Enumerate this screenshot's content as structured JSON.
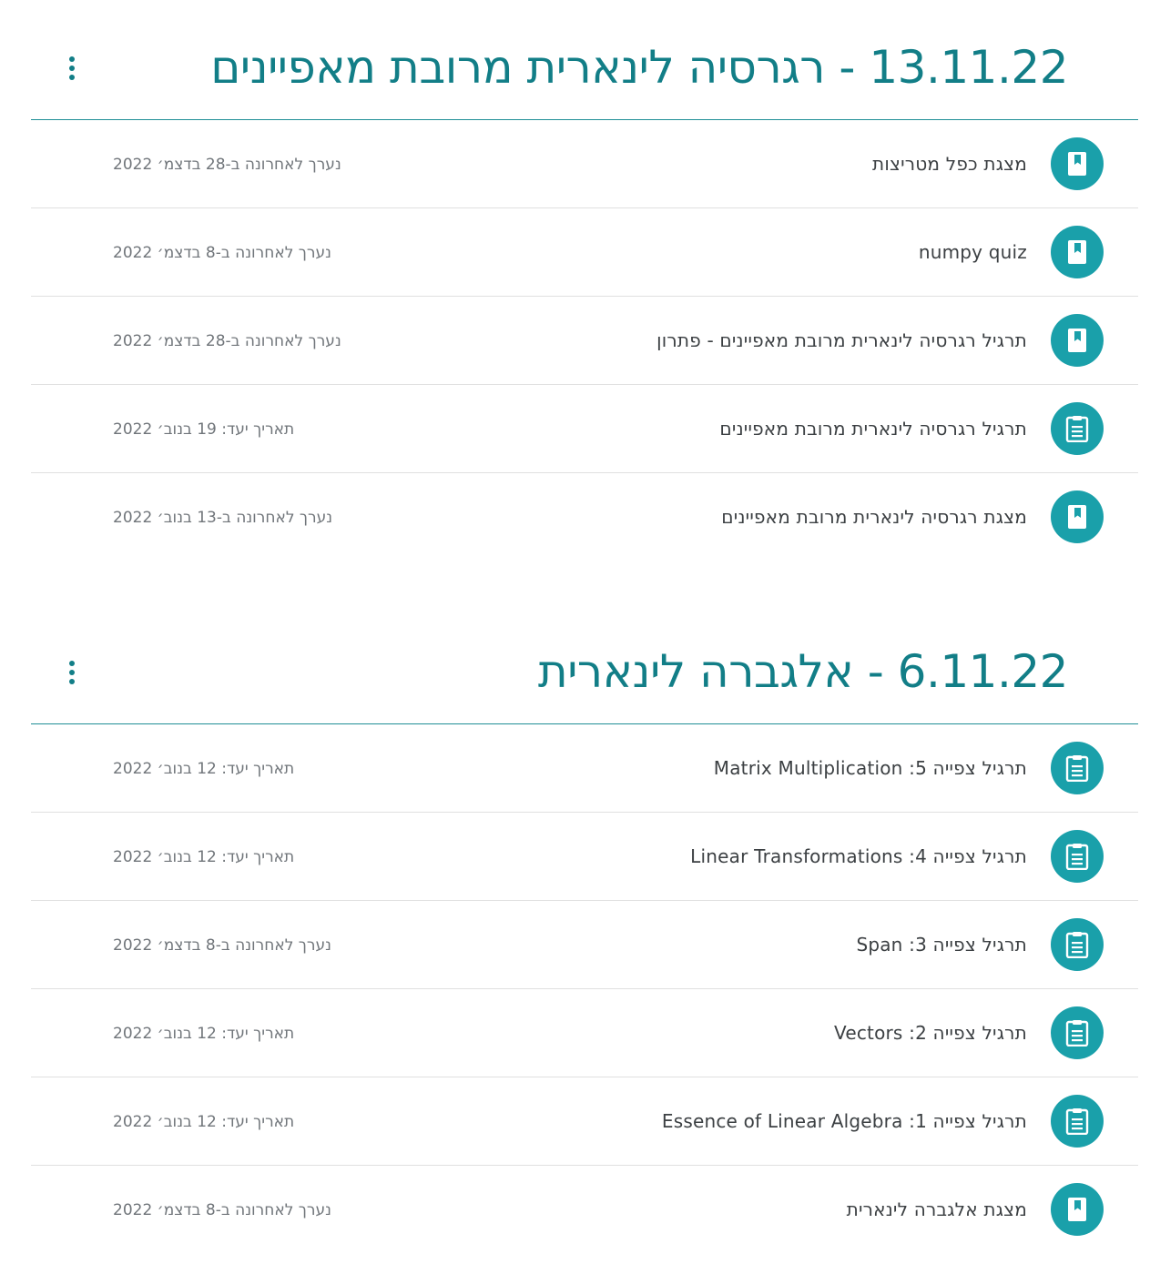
{
  "topics": [
    {
      "title": "13.11.22 - רגרסיה לינארית מרובת מאפיינים",
      "items": [
        {
          "type": "material",
          "icon": "book-icon",
          "title": "מצגת כפל מטריצות",
          "meta": "נערך לאחרונה ב-28 בדצמ׳ 2022"
        },
        {
          "type": "material",
          "icon": "book-icon",
          "title": "numpy quiz",
          "meta": "נערך לאחרונה ב-8 בדצמ׳ 2022"
        },
        {
          "type": "material",
          "icon": "book-icon",
          "title": "תרגיל רגרסיה לינארית מרובת מאפיינים - פתרון",
          "meta": "נערך לאחרונה ב-28 בדצמ׳ 2022"
        },
        {
          "type": "assignment",
          "icon": "assignment-icon",
          "title": "תרגיל רגרסיה לינארית מרובת מאפיינים",
          "meta": "תאריך יעד: 19 בנוב׳ 2022"
        },
        {
          "type": "material",
          "icon": "book-icon",
          "title": "מצגת רגרסיה לינארית מרובת מאפיינים",
          "meta": "נערך לאחרונה ב-13 בנוב׳ 2022"
        }
      ]
    },
    {
      "title": "6.11.22 - אלגברה לינארית",
      "items": [
        {
          "type": "assignment",
          "icon": "assignment-icon",
          "title": "תרגיל צפייה 5: Matrix Multiplication",
          "meta": "תאריך יעד: 12 בנוב׳ 2022"
        },
        {
          "type": "assignment",
          "icon": "assignment-icon",
          "title": "תרגיל צפייה 4: Linear Transformations",
          "meta": "תאריך יעד: 12 בנוב׳ 2022"
        },
        {
          "type": "assignment",
          "icon": "assignment-icon",
          "title": "תרגיל צפייה 3: Span",
          "meta": "נערך לאחרונה ב-8 בדצמ׳ 2022"
        },
        {
          "type": "assignment",
          "icon": "assignment-icon",
          "title": "תרגיל צפייה 2: Vectors",
          "meta": "תאריך יעד: 12 בנוב׳ 2022"
        },
        {
          "type": "assignment",
          "icon": "assignment-icon",
          "title": "תרגיל צפייה 1: Essence of Linear Algebra",
          "meta": "תאריך יעד: 12 בנוב׳ 2022"
        },
        {
          "type": "material",
          "icon": "book-icon",
          "title": "מצגת אלגברה לינארית",
          "meta": "נערך לאחרונה ב-8 בדצמ׳ 2022"
        }
      ]
    }
  ],
  "colors": {
    "accent": "#127e87",
    "icon_bg": "#1aa0aa",
    "divider": "#e0e0e0",
    "text": "#3c4043",
    "meta_text": "#70757a"
  }
}
